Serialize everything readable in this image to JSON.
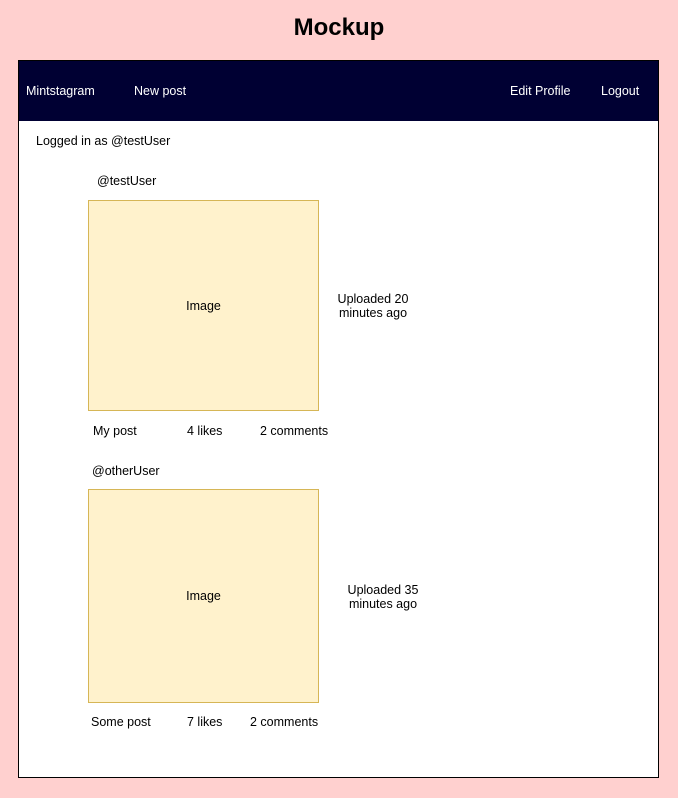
{
  "page": {
    "title": "Mockup"
  },
  "nav": {
    "brand": "Mintstagram",
    "new_post": "New post",
    "edit_profile": "Edit Profile",
    "logout": "Logout",
    "background": "#000033"
  },
  "session": {
    "logged_in_text": "Logged in as @testUser"
  },
  "posts": [
    {
      "author": "@testUser",
      "image_label": "Image",
      "uploaded": "Uploaded 20 minutes ago",
      "caption": "My post",
      "likes": "4 likes",
      "comments": "2 comments"
    },
    {
      "author": "@otherUser",
      "image_label": "Image",
      "uploaded": "Uploaded 35 minutes ago",
      "caption": "Some post",
      "likes": "7 likes",
      "comments": "2 comments"
    }
  ],
  "colors": {
    "page_background": "#ffd0cf",
    "image_fill": "#fff2cc",
    "image_border": "#d6b656"
  }
}
